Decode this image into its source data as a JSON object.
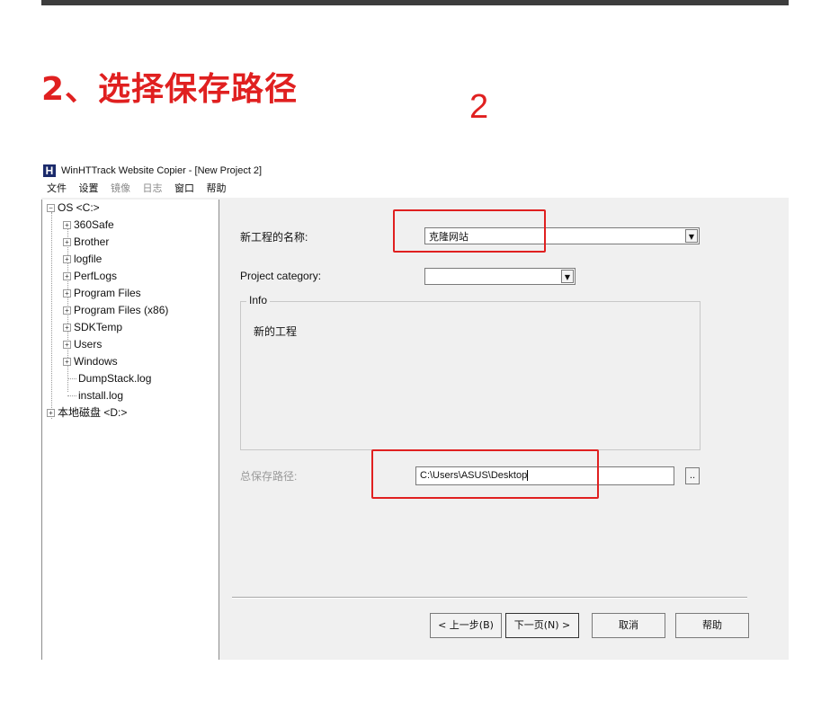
{
  "step": {
    "title": "2、选择保存路径",
    "number": "2"
  },
  "window": {
    "title": "WinHTTrack Website Copier - [New Project 2]",
    "logo": "H",
    "menu": [
      "文件",
      "设置",
      "镜像",
      "日志",
      "窗口",
      "帮助"
    ]
  },
  "tree": {
    "root_c": "OS <C:>",
    "children": [
      "360Safe",
      "Brother",
      "logfile",
      "PerfLogs",
      "Program Files",
      "Program Files (x86)",
      "SDKTemp",
      "Users",
      "Windows"
    ],
    "files": [
      "DumpStack.log",
      "install.log"
    ],
    "root_d": "本地磁盘 <D:>"
  },
  "form": {
    "project_name_label": "新工程的名称:",
    "project_name_value": "克隆网站",
    "category_label": "Project category:",
    "category_value": "",
    "info_legend": "Info",
    "info_text": "新的工程",
    "path_label": "总保存路径:",
    "path_value": "C:\\Users\\ASUS\\Desktop",
    "browse_label": ".."
  },
  "buttons": {
    "back": "< 上一步(B)",
    "next": "下一页(N) >",
    "cancel": "取消",
    "help": "帮助"
  },
  "colors": {
    "highlight": "#e02020",
    "title_red": "#e02020"
  }
}
